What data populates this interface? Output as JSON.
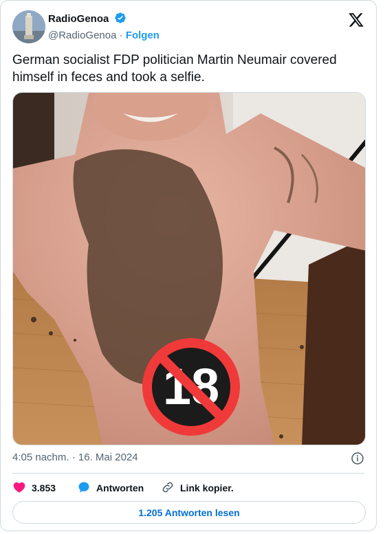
{
  "author": {
    "display_name": "RadioGenoa",
    "handle": "@RadioGenoa",
    "separator": "·",
    "follow_label": "Folgen"
  },
  "tweet": {
    "text": "German socialist FDP politician Martin Neumair covered himself in feces and took a selfie.",
    "timestamp": "4:05 nachm. · 16. Mai 2024"
  },
  "actions": {
    "likes_count": "3.853",
    "reply_label": "Antworten",
    "copy_link_label": "Link kopier."
  },
  "read_replies_label": "1.205 Antworten lesen",
  "colors": {
    "accent": "#1d9bf0",
    "like": "#f91880",
    "text": "#0f1419",
    "muted": "#536471",
    "border": "#cfd9de"
  },
  "icons": [
    "verified-badge-icon",
    "x-logo-icon",
    "info-icon",
    "heart-icon",
    "reply-bubble-icon",
    "link-icon",
    "no-under-18-icon"
  ]
}
